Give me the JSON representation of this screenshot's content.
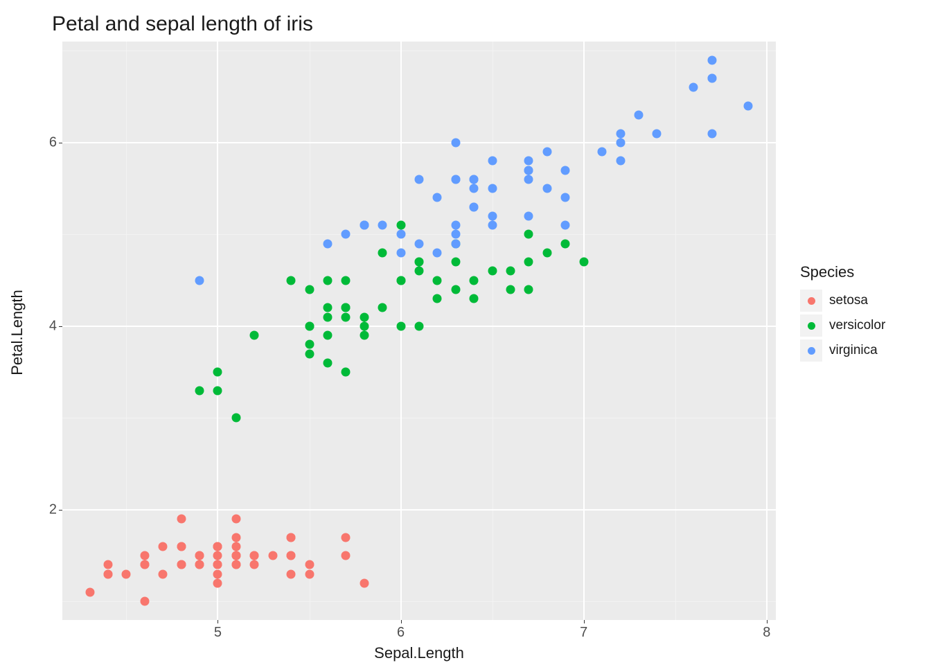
{
  "chart_data": {
    "type": "scatter",
    "title": "Petal and sepal length of iris",
    "xlabel": "Sepal.Length",
    "ylabel": "Petal.Length",
    "xlim": [
      4.15,
      8.05
    ],
    "ylim": [
      0.8,
      7.1
    ],
    "x_ticks": [
      5,
      6,
      7,
      8
    ],
    "y_ticks": [
      2,
      4,
      6
    ],
    "x_minor": [
      4.5,
      5.5,
      6.5,
      7.5
    ],
    "y_minor": [
      1,
      3,
      5,
      7
    ],
    "legend": {
      "title": "Species",
      "items": [
        "setosa",
        "versicolor",
        "virginica"
      ]
    },
    "colors": {
      "setosa": "#f8766d",
      "versicolor": "#00ba38",
      "virginica": "#619cff"
    },
    "series": [
      {
        "name": "setosa",
        "points": [
          [
            5.1,
            1.4
          ],
          [
            4.9,
            1.4
          ],
          [
            4.7,
            1.3
          ],
          [
            4.6,
            1.5
          ],
          [
            5.0,
            1.4
          ],
          [
            5.4,
            1.7
          ],
          [
            4.6,
            1.4
          ],
          [
            5.0,
            1.5
          ],
          [
            4.4,
            1.4
          ],
          [
            4.9,
            1.5
          ],
          [
            5.4,
            1.5
          ],
          [
            4.8,
            1.6
          ],
          [
            4.8,
            1.4
          ],
          [
            4.3,
            1.1
          ],
          [
            5.8,
            1.2
          ],
          [
            5.7,
            1.5
          ],
          [
            5.4,
            1.3
          ],
          [
            5.1,
            1.4
          ],
          [
            5.7,
            1.7
          ],
          [
            5.1,
            1.5
          ],
          [
            5.4,
            1.7
          ],
          [
            5.1,
            1.5
          ],
          [
            4.6,
            1.0
          ],
          [
            5.1,
            1.7
          ],
          [
            4.8,
            1.9
          ],
          [
            5.0,
            1.6
          ],
          [
            5.0,
            1.6
          ],
          [
            5.2,
            1.5
          ],
          [
            5.2,
            1.4
          ],
          [
            4.7,
            1.6
          ],
          [
            4.8,
            1.6
          ],
          [
            5.4,
            1.5
          ],
          [
            5.2,
            1.5
          ],
          [
            5.5,
            1.4
          ],
          [
            4.9,
            1.5
          ],
          [
            5.0,
            1.2
          ],
          [
            5.5,
            1.3
          ],
          [
            4.9,
            1.4
          ],
          [
            4.4,
            1.3
          ],
          [
            5.1,
            1.5
          ],
          [
            5.0,
            1.3
          ],
          [
            4.5,
            1.3
          ],
          [
            4.4,
            1.3
          ],
          [
            5.0,
            1.6
          ],
          [
            5.1,
            1.9
          ],
          [
            4.8,
            1.4
          ],
          [
            5.1,
            1.6
          ],
          [
            4.6,
            1.4
          ],
          [
            5.3,
            1.5
          ],
          [
            5.0,
            1.4
          ]
        ]
      },
      {
        "name": "versicolor",
        "points": [
          [
            7.0,
            4.7
          ],
          [
            6.4,
            4.5
          ],
          [
            6.9,
            4.9
          ],
          [
            5.5,
            4.0
          ],
          [
            6.5,
            4.6
          ],
          [
            5.7,
            4.5
          ],
          [
            6.3,
            4.7
          ],
          [
            4.9,
            3.3
          ],
          [
            6.6,
            4.6
          ],
          [
            5.2,
            3.9
          ],
          [
            5.0,
            3.5
          ],
          [
            5.9,
            4.2
          ],
          [
            6.0,
            4.0
          ],
          [
            6.1,
            4.7
          ],
          [
            5.6,
            3.6
          ],
          [
            6.7,
            4.4
          ],
          [
            5.6,
            4.5
          ],
          [
            5.8,
            4.1
          ],
          [
            6.2,
            4.5
          ],
          [
            5.6,
            3.9
          ],
          [
            5.9,
            4.8
          ],
          [
            6.1,
            4.0
          ],
          [
            6.3,
            4.9
          ],
          [
            6.1,
            4.7
          ],
          [
            6.4,
            4.3
          ],
          [
            6.6,
            4.4
          ],
          [
            6.8,
            4.8
          ],
          [
            6.7,
            5.0
          ],
          [
            6.0,
            4.5
          ],
          [
            5.7,
            3.5
          ],
          [
            5.5,
            3.8
          ],
          [
            5.5,
            3.7
          ],
          [
            5.8,
            3.9
          ],
          [
            6.0,
            5.1
          ],
          [
            5.4,
            4.5
          ],
          [
            6.0,
            4.5
          ],
          [
            6.7,
            4.7
          ],
          [
            6.3,
            4.4
          ],
          [
            5.6,
            4.1
          ],
          [
            5.5,
            4.0
          ],
          [
            5.5,
            4.4
          ],
          [
            6.1,
            4.6
          ],
          [
            5.8,
            4.0
          ],
          [
            5.0,
            3.3
          ],
          [
            5.6,
            4.2
          ],
          [
            5.7,
            4.2
          ],
          [
            5.7,
            4.2
          ],
          [
            6.2,
            4.3
          ],
          [
            5.1,
            3.0
          ],
          [
            5.7,
            4.1
          ]
        ]
      },
      {
        "name": "virginica",
        "points": [
          [
            6.3,
            6.0
          ],
          [
            5.8,
            5.1
          ],
          [
            7.1,
            5.9
          ],
          [
            6.3,
            5.6
          ],
          [
            6.5,
            5.8
          ],
          [
            7.6,
            6.6
          ],
          [
            4.9,
            4.5
          ],
          [
            7.3,
            6.3
          ],
          [
            6.7,
            5.8
          ],
          [
            7.2,
            6.1
          ],
          [
            6.5,
            5.1
          ],
          [
            6.4,
            5.3
          ],
          [
            6.8,
            5.5
          ],
          [
            5.7,
            5.0
          ],
          [
            5.8,
            5.1
          ],
          [
            6.4,
            5.3
          ],
          [
            6.5,
            5.5
          ],
          [
            7.7,
            6.7
          ],
          [
            7.7,
            6.9
          ],
          [
            6.0,
            5.0
          ],
          [
            6.9,
            5.7
          ],
          [
            5.6,
            4.9
          ],
          [
            7.7,
            6.7
          ],
          [
            6.3,
            4.9
          ],
          [
            6.7,
            5.7
          ],
          [
            7.2,
            6.0
          ],
          [
            6.2,
            4.8
          ],
          [
            6.1,
            4.9
          ],
          [
            6.4,
            5.6
          ],
          [
            7.2,
            5.8
          ],
          [
            7.4,
            6.1
          ],
          [
            7.9,
            6.4
          ],
          [
            6.4,
            5.6
          ],
          [
            6.3,
            5.1
          ],
          [
            6.1,
            5.6
          ],
          [
            7.7,
            6.1
          ],
          [
            6.3,
            5.6
          ],
          [
            6.4,
            5.5
          ],
          [
            6.0,
            4.8
          ],
          [
            6.9,
            5.4
          ],
          [
            6.7,
            5.6
          ],
          [
            6.9,
            5.1
          ],
          [
            5.8,
            5.1
          ],
          [
            6.8,
            5.9
          ],
          [
            6.7,
            5.7
          ],
          [
            6.7,
            5.2
          ],
          [
            6.3,
            5.0
          ],
          [
            6.5,
            5.2
          ],
          [
            6.2,
            5.4
          ],
          [
            5.9,
            5.1
          ]
        ]
      }
    ]
  }
}
